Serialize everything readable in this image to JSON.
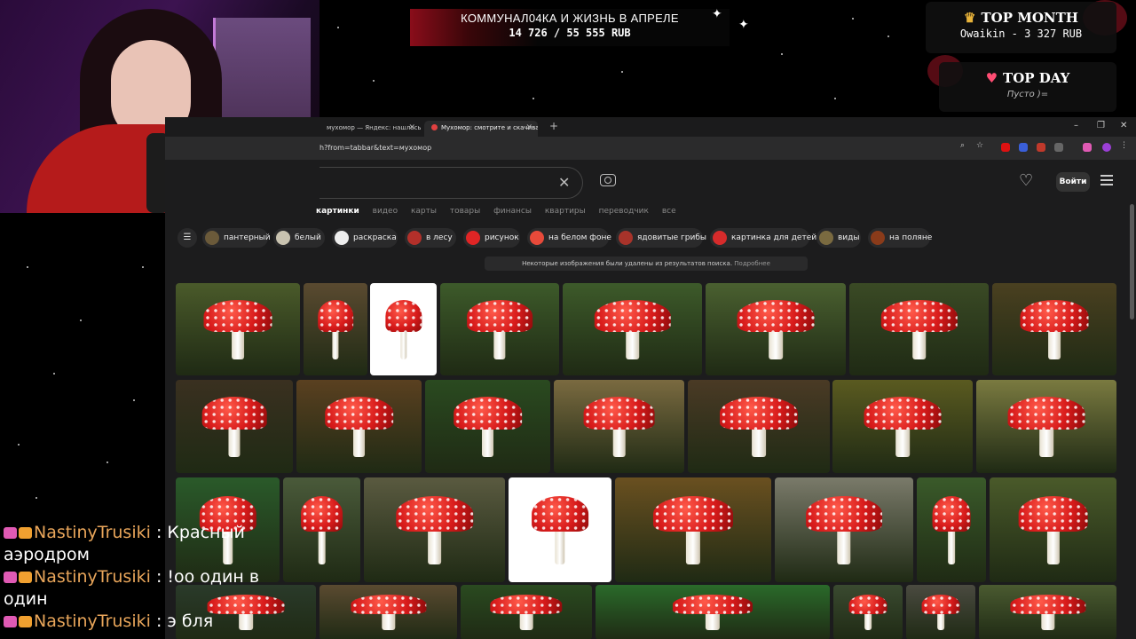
{
  "overlay": {
    "goal_title": "КОММУНАЛ04КА И ЖИЗНЬ В АПРЕЛЕ",
    "goal_amount": "14 726 / 55 555 RUB",
    "top_month_title": "TOP MONTH",
    "top_month_entry": "Owaikin  -  3 327 RUB",
    "top_day_title": "TOP DAY",
    "top_day_entry": "Пусто )="
  },
  "browser": {
    "tabs": [
      {
        "label": "мухомор — Яндекс: нашлось"
      },
      {
        "label": "Мухомор: смотрите и скачива"
      }
    ],
    "url": "h?from=tabbar&text=мухомор"
  },
  "page": {
    "login_label": "Войти",
    "nav": [
      "картинки",
      "видео",
      "карты",
      "товары",
      "финансы",
      "квартиры",
      "переводчик",
      "все"
    ],
    "chips": [
      "пантерный",
      "белый",
      "раскраска",
      "в лесу",
      "рисунок",
      "на белом фоне",
      "ядовитые грибы",
      "картинка для детей",
      "виды",
      "на поляне"
    ],
    "notice_text": "Некоторые изображения были удалены из результатов поиска.",
    "notice_link": "Подробнее"
  },
  "chat": [
    {
      "user": "NastinyTrusiki",
      "message": "Красный аэродром"
    },
    {
      "user": "NastinyTrusiki",
      "message": "!оо один в один"
    },
    {
      "user": "NastinyTrusiki",
      "message": "э бля"
    }
  ],
  "colors": {
    "accent_red": "#d81b1b",
    "chat_user": "#e8a55a",
    "page_bg": "#1c1c1d"
  }
}
